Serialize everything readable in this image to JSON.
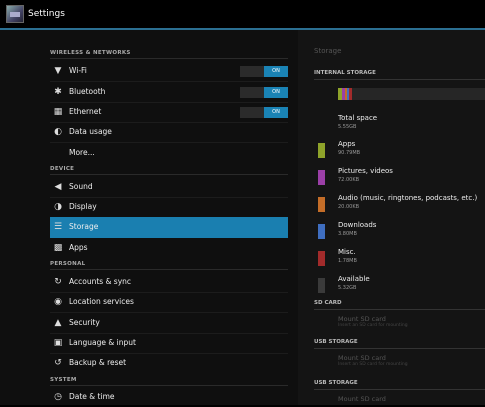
{
  "app": {
    "title": "Settings"
  },
  "sections": {
    "wireless": "WIRELESS & NETWORKS",
    "device": "DEVICE",
    "personal": "PERSONAL",
    "system": "SYSTEM"
  },
  "menu": {
    "wifi": "Wi-Fi",
    "bluetooth": "Bluetooth",
    "ethernet": "Ethernet",
    "data_usage": "Data usage",
    "more": "More...",
    "sound": "Sound",
    "display": "Display",
    "storage": "Storage",
    "apps": "Apps",
    "accounts": "Accounts & sync",
    "location": "Location services",
    "security": "Security",
    "language": "Language & input",
    "backup": "Backup & reset",
    "datetime": "Date & time"
  },
  "toggles": {
    "wifi": "ON",
    "bluetooth": "ON",
    "ethernet": "ON"
  },
  "storage": {
    "title": "Storage",
    "internal_header": "INTERNAL STORAGE",
    "total_label": "Total space",
    "total_value": "5.55GB",
    "items": [
      {
        "name": "Apps",
        "size": "90.79MB",
        "color": "#8ea32a"
      },
      {
        "name": "Pictures, videos",
        "size": "72.00KB",
        "color": "#9b3fa7"
      },
      {
        "name": "Audio (music, ringtones, podcasts, etc.)",
        "size": "20.00KB",
        "color": "#c46d28"
      },
      {
        "name": "Downloads",
        "size": "3.80MB",
        "color": "#3f6ec0"
      },
      {
        "name": "Misc.",
        "size": "1.78MB",
        "color": "#a22b2b"
      },
      {
        "name": "Available",
        "size": "5.32GB",
        "color": "#3a3a3a"
      }
    ],
    "sd_header": "SD CARD",
    "sd_mount": "Mount SD card",
    "sd_hint": "Insert an SD card for mounting",
    "usb_header": "USB STORAGE",
    "usb_mount": "Mount SD card",
    "usb_hint": "Insert an SD card for mounting",
    "usb2_header": "USB STORAGE",
    "usb2_mount": "Mount SD card"
  }
}
